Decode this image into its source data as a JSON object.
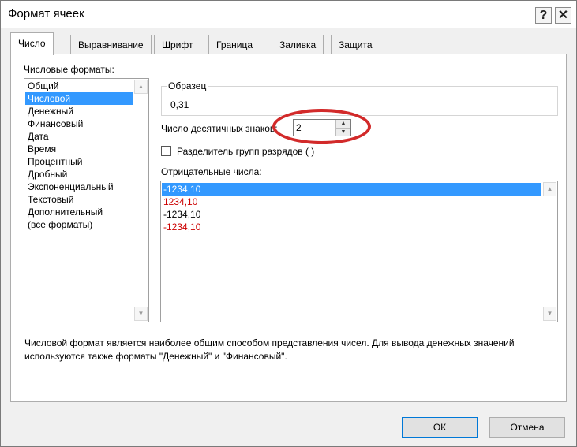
{
  "dialog": {
    "title": "Формат ячеек",
    "help_label": "?",
    "close_label": "✕"
  },
  "tabs": [
    {
      "label": "Число",
      "active": true
    },
    {
      "label": "Выравнивание",
      "active": false
    },
    {
      "label": "Шрифт",
      "active": false
    },
    {
      "label": "Граница",
      "active": false
    },
    {
      "label": "Заливка",
      "active": false
    },
    {
      "label": "Защита",
      "active": false
    }
  ],
  "number_tab": {
    "formats_label": "Числовые форматы:",
    "formats": [
      "Общий",
      "Числовой",
      "Денежный",
      "Финансовый",
      "Дата",
      "Время",
      "Процентный",
      "Дробный",
      "Экспоненциальный",
      "Текстовый",
      "Дополнительный",
      "(все форматы)"
    ],
    "selected_format": "Числовой",
    "sample_label": "Образец",
    "sample_value": "0,31",
    "decimals_label": "Число десятичных знаков:",
    "decimals_value": "2",
    "separator_label": "Разделитель групп разрядов ( )",
    "separator_checked": false,
    "negative_label": "Отрицательные числа:",
    "negative_options": [
      {
        "text": "-1234,10",
        "color": "#ffffff",
        "selected": true
      },
      {
        "text": "1234,10",
        "color": "#cc0000",
        "selected": false
      },
      {
        "text": "-1234,10",
        "color": "#000000",
        "selected": false
      },
      {
        "text": "-1234,10",
        "color": "#cc0000",
        "selected": false
      }
    ],
    "description_line1": "Числовой формат является наиболее общим способом представления чисел. Для вывода денежных значений",
    "description_line2": "используются также форматы \"Денежный\" и \"Финансовый\"."
  },
  "buttons": {
    "ok": "ОК",
    "cancel": "Отмена"
  },
  "colors": {
    "selection": "#3399ff",
    "annotation": "#d22a2a",
    "negative_red": "#cc0000"
  }
}
